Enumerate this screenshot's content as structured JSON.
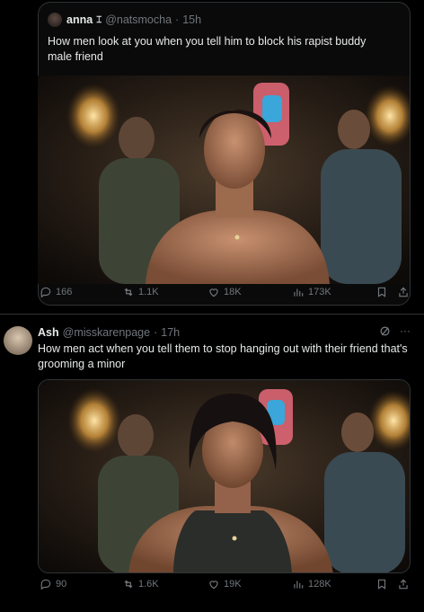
{
  "tweet1": {
    "name": "anna",
    "name_glyph": "⌶",
    "handle": "@natsmocha",
    "time": "15h",
    "text": "How men look at you when you tell him to block his rapist buddy male friend",
    "actions": {
      "replies": "166",
      "reposts": "1.1K",
      "likes": "18K",
      "views": "173K"
    }
  },
  "tweet2": {
    "name": "Ash",
    "handle": "@misskarenpage",
    "time": "17h",
    "text": "How men act when you tell them to stop hanging out with their friend that's grooming a minor",
    "actions": {
      "replies": "90",
      "reposts": "1.6K",
      "likes": "19K",
      "views": "128K"
    }
  },
  "sep": "·",
  "more": "···",
  "colors": {
    "background": "#000000",
    "text": "#e7e9ea",
    "muted": "#71767b",
    "border": "#2f3336"
  }
}
